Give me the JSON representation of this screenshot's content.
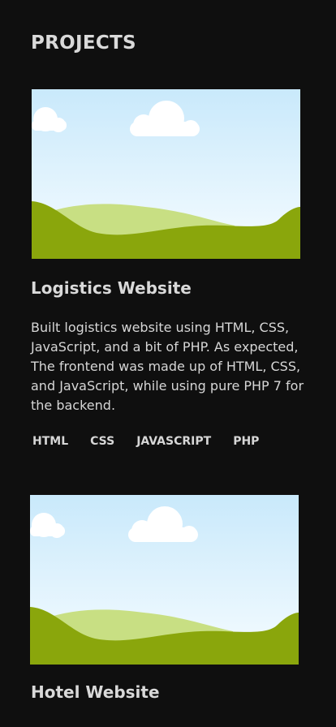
{
  "section_title": "PROJECTS",
  "projects": [
    {
      "title": "Logistics Website",
      "description": "Built logistics website using HTML, CSS, JavaScript, and a bit of PHP. As expected, The frontend was made up of HTML, CSS, and JavaScript, while using pure PHP 7 for the backend.",
      "tags": [
        "HTML",
        "CSS",
        "JAVASCRIPT",
        "PHP"
      ],
      "thumbnail_icon": "landscape-placeholder-image"
    },
    {
      "title": "Hotel Website",
      "thumbnail_icon": "landscape-placeholder-image"
    }
  ],
  "colors": {
    "background": "#0f0f0f",
    "text": "#d9d9d9",
    "sky_top": "#c9e9fb",
    "sky_bottom": "#f3fbff",
    "hill_light": "#c8df83",
    "hill_dark": "#8aa60c"
  }
}
